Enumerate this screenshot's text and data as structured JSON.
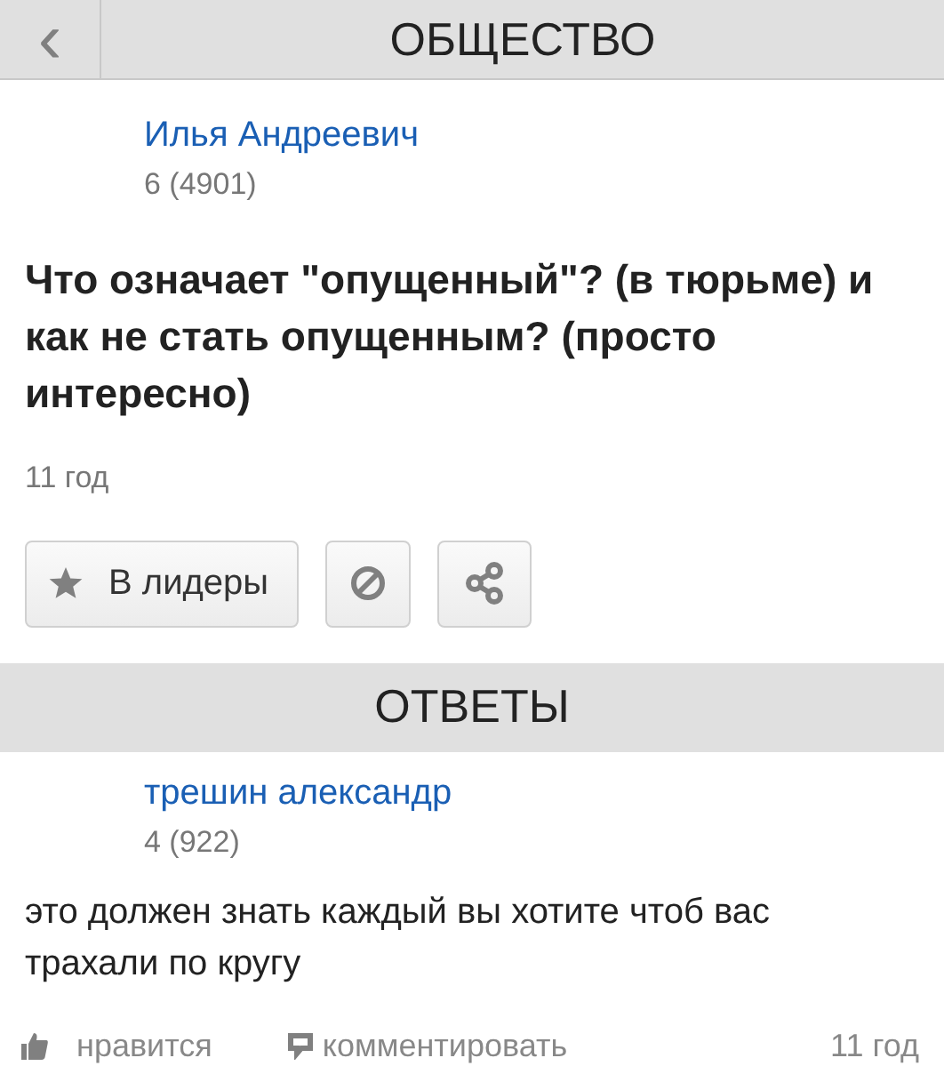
{
  "header": {
    "back": "‹",
    "title": "ОБЩЕСТВО"
  },
  "question": {
    "author": "Илья Андреевич",
    "score": "6 (4901)",
    "text": "Что означает \"опущенный\"? (в тюрьме) и как не стать опущенным? (просто интересно)",
    "time": "11 год",
    "leader_button": "В лидеры"
  },
  "answers_header": "ОТВЕТЫ",
  "answers": [
    {
      "author": "трешин александр",
      "score": "4 (922)",
      "text": "это должен знать каждый вы хотите чтоб вас трахали по кругу",
      "like": "нравится",
      "comment": "комментировать",
      "time": "11 год"
    }
  ]
}
